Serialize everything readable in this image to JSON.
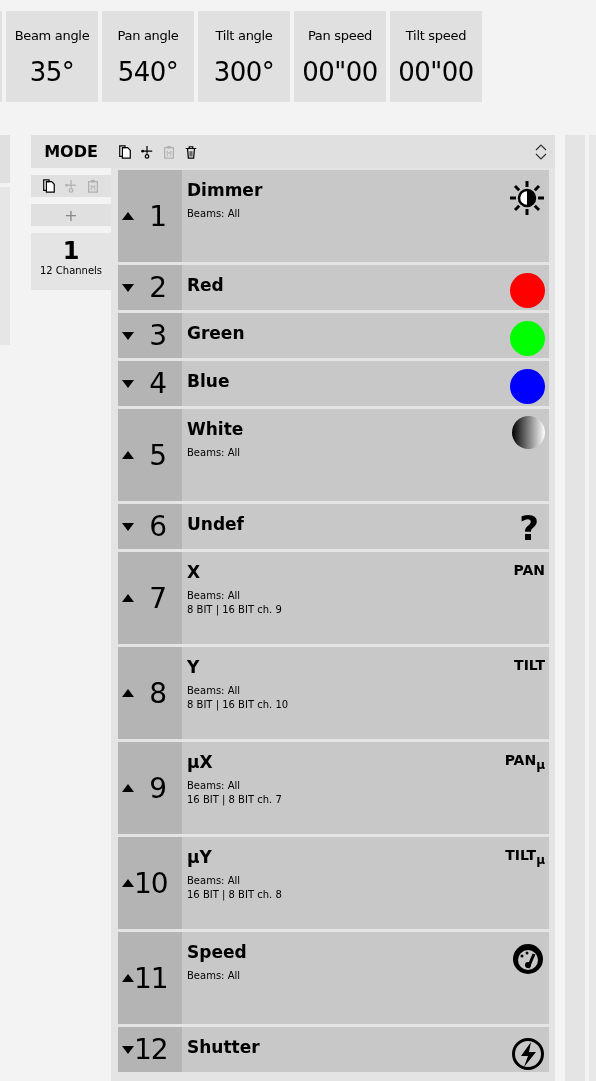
{
  "properties": [
    {
      "label": "Beam angle",
      "value": "35°"
    },
    {
      "label": "Pan angle",
      "value": "540°"
    },
    {
      "label": "Tilt angle",
      "value": "300°"
    },
    {
      "label": "Pan speed",
      "value": "00\"00"
    },
    {
      "label": "Tilt speed",
      "value": "00\"00"
    }
  ],
  "mode_panel": {
    "title": "MODE",
    "toolbar": [
      {
        "kind": "copy",
        "disabled": false
      },
      {
        "kind": "cut",
        "disabled": false
      },
      {
        "kind": "paste",
        "disabled": true
      },
      {
        "kind": "delete",
        "disabled": false
      }
    ],
    "mode_toolbar": [
      {
        "kind": "copy",
        "disabled": false
      },
      {
        "kind": "cut",
        "disabled": true
      },
      {
        "kind": "paste",
        "disabled": true
      }
    ],
    "add_button": "+",
    "modes": [
      {
        "number": "1",
        "channels": "12 Channels",
        "selected": true
      }
    ],
    "channels": [
      {
        "number": "1",
        "name": "Dimmer",
        "expanded": true,
        "details": [
          "Beams: All"
        ],
        "icon": {
          "kind": "dimmer"
        }
      },
      {
        "number": "2",
        "name": "Red",
        "expanded": false,
        "icon": {
          "kind": "dot",
          "color": "#ff0000"
        }
      },
      {
        "number": "3",
        "name": "Green",
        "expanded": false,
        "icon": {
          "kind": "dot",
          "color": "#00ff00"
        }
      },
      {
        "number": "4",
        "name": "Blue",
        "expanded": false,
        "icon": {
          "kind": "dot",
          "color": "#0000ff"
        }
      },
      {
        "number": "5",
        "name": "White",
        "expanded": true,
        "details": [
          "Beams: All"
        ],
        "icon": {
          "kind": "gradient"
        }
      },
      {
        "number": "6",
        "name": "Undef",
        "expanded": false,
        "icon": {
          "kind": "glyph",
          "text": "?"
        }
      },
      {
        "number": "7",
        "name": "X",
        "expanded": true,
        "details": [
          "Beams: All",
          "8 BIT | 16 BIT ch. 9"
        ],
        "icon": {
          "kind": "label",
          "text": "PAN"
        }
      },
      {
        "number": "8",
        "name": "Y",
        "expanded": true,
        "details": [
          "Beams: All",
          "8 BIT | 16 BIT ch. 10"
        ],
        "icon": {
          "kind": "label",
          "text": "TILT"
        }
      },
      {
        "number": "9",
        "name": "µX",
        "expanded": true,
        "details": [
          "Beams: All",
          "16 BIT | 8 BIT ch. 7"
        ],
        "icon": {
          "kind": "label",
          "text": "PAN",
          "sub": "µ"
        }
      },
      {
        "number": "10",
        "name": "µY",
        "expanded": true,
        "details": [
          "Beams: All",
          "16 BIT | 8 BIT ch. 8"
        ],
        "icon": {
          "kind": "label",
          "text": "TILT",
          "sub": "µ"
        }
      },
      {
        "number": "11",
        "name": "Speed",
        "expanded": true,
        "details": [
          "Beams: All"
        ],
        "icon": {
          "kind": "speed"
        }
      },
      {
        "number": "12",
        "name": "Shutter",
        "expanded": false,
        "icon": {
          "kind": "shutter"
        }
      }
    ]
  }
}
